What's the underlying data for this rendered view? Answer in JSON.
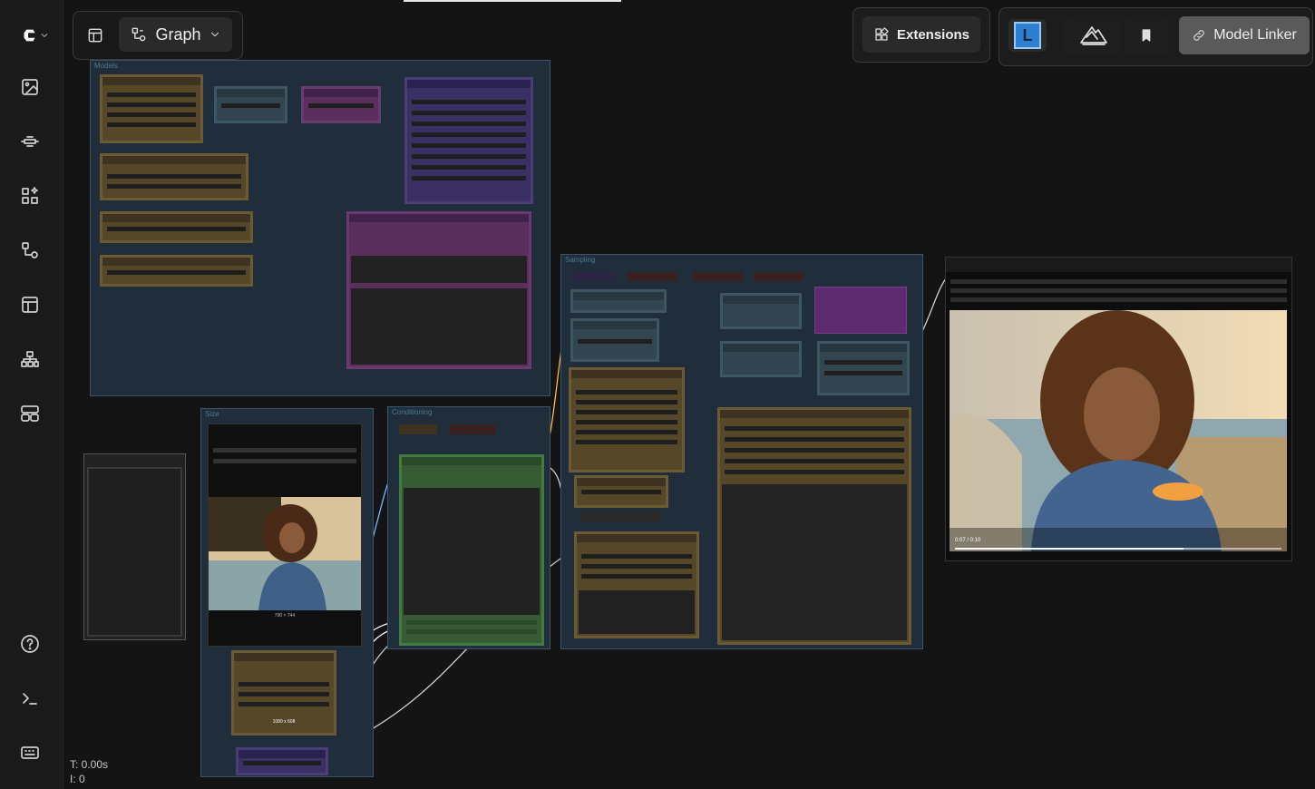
{
  "toolbar": {
    "graph_label": "Graph",
    "extensions_label": "Extensions",
    "model_linker_label": "Model Linker",
    "l_badge": "L"
  },
  "groups": {
    "models": "Models",
    "sampling": "Sampling",
    "size": "Size",
    "conditioning": "Conditioning"
  },
  "nodes": {
    "size_preview_caption": "790 × 744",
    "size_display": "1080 x 608",
    "video_time": "0:07 / 0:10"
  },
  "stats": {
    "time": "T: 0.00s",
    "iterations": "I: 0"
  },
  "icons": {
    "sidebar": [
      "comfy-logo",
      "images-icon",
      "models-icon",
      "nodes-icon",
      "workflows-icon",
      "templates-icon",
      "node-tree-icon",
      "panel-layout-icon",
      "help-icon",
      "terminal-icon",
      "keyboard-icon"
    ]
  },
  "colors": {
    "group_bg": "#1f2e3a",
    "node_brown": "#554728",
    "node_purple": "#5a2f5e",
    "node_green": "#355a34",
    "node_slate": "#334550",
    "accent_blue": "#2d7fd1"
  }
}
